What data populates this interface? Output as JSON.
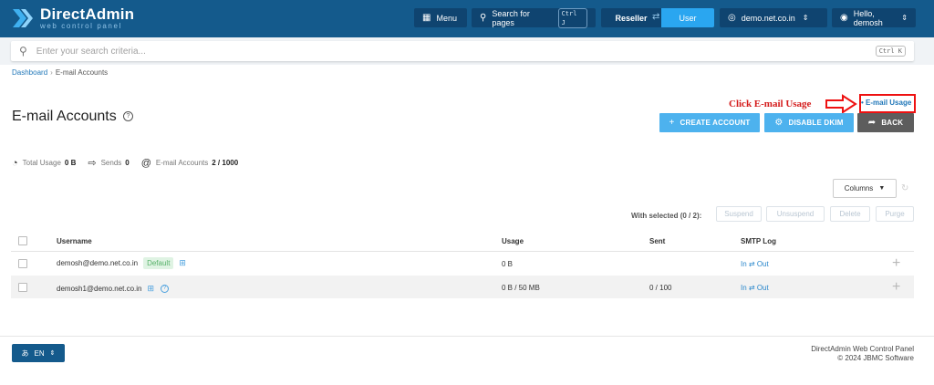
{
  "brand": {
    "title": "DirectAdmin",
    "subtitle": "web control panel",
    "primary_color": "#145a8c",
    "accent_color": "#2aa6f0"
  },
  "topbar": {
    "menu_label": "Menu",
    "menu_icon": "grid-icon",
    "search_label": "Search for pages",
    "search_shortcut": "Ctrl J",
    "role_reseller": "Reseller",
    "role_user": "User",
    "domain_label": "demo.net.co.in",
    "user_label": "Hello, demosh"
  },
  "search": {
    "placeholder": "Enter your search criteria...",
    "shortcut": "Ctrl K"
  },
  "breadcrumb": {
    "home": "Dashboard",
    "current": "E-mail Accounts"
  },
  "page": {
    "title": "E-mail Accounts"
  },
  "annotation": {
    "text": "Click E-mail Usage",
    "color": "#d41c1c"
  },
  "actions": {
    "email_usage": "E-mail Usage",
    "create_account": "CREATE ACCOUNT",
    "disable_dkim": "DISABLE DKIM",
    "back": "BACK"
  },
  "stats": {
    "total_usage_label": "Total Usage",
    "total_usage_value": "0 B",
    "sends_label": "Sends",
    "sends_value": "0",
    "accounts_label": "E-mail Accounts",
    "accounts_value": "2 / 1000"
  },
  "toolbar": {
    "columns_label": "Columns",
    "with_selected": "With selected (0 / 2):",
    "suspend": "Suspend",
    "unsuspend": "Unsuspend",
    "delete": "Delete",
    "purge": "Purge"
  },
  "table": {
    "headers": {
      "username": "Username",
      "usage": "Usage",
      "sent": "Sent",
      "smtp_log": "SMTP Log"
    },
    "rows": [
      {
        "username": "demosh@demo.net.co.in",
        "badge": "Default",
        "usage": "0 B",
        "sent": "",
        "smtp": "In ⇄ Out"
      },
      {
        "username": "demosh1@demo.net.co.in",
        "badge": "",
        "usage": "0 B / 50 MB",
        "sent": "0 / 100",
        "smtp": "In ⇄ Out"
      }
    ]
  },
  "footer": {
    "language": "EN",
    "product": "DirectAdmin Web Control Panel",
    "copyright": "© 2024 JBMC Software"
  }
}
